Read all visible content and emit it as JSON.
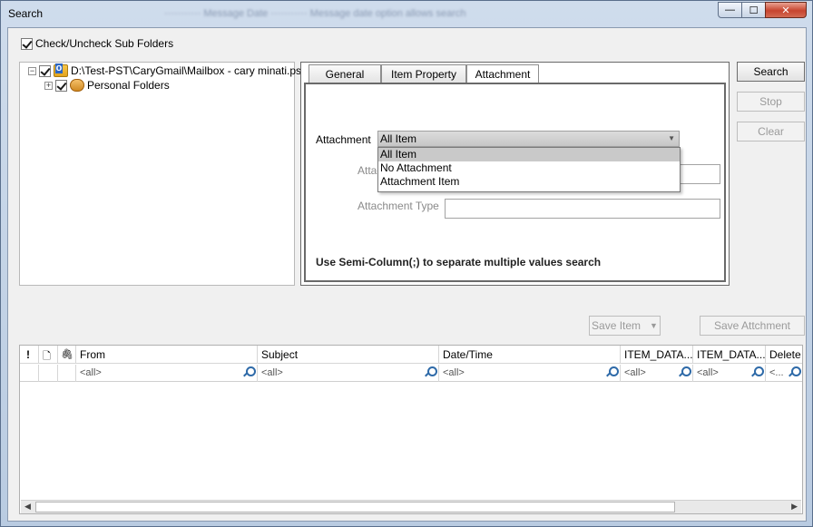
{
  "window": {
    "title": "Search",
    "controls": {
      "minimize": "—",
      "maximize": "☐",
      "close": "✕"
    }
  },
  "options": {
    "sub_folders_label": "Check/Uncheck Sub Folders",
    "sub_folders_checked": true
  },
  "tree": {
    "root": {
      "label": "D:\\Test-PST\\CaryGmail\\Mailbox - cary minati.pst",
      "expander": "−",
      "checked": true
    },
    "child": {
      "label": "Personal Folders",
      "expander": "+",
      "checked": true
    }
  },
  "tabs": {
    "general": "General",
    "item_property": "Item Property",
    "attachment": "Attachment",
    "active": "Attachment"
  },
  "attachment_tab": {
    "attachment_label": "Attachment",
    "selected": "All Item",
    "options": [
      "All Item",
      "No Attachment",
      "Attachment Item"
    ],
    "name_label_partial": "Attac",
    "type_label": "Attachment Type",
    "hint": "Use Semi-Column(;) to separate multiple values search"
  },
  "buttons": {
    "search": "Search",
    "stop": "Stop",
    "clear": "Clear",
    "save_item": "Save Item",
    "save_attachment": "Save Attchment"
  },
  "grid": {
    "icon_columns": [
      "!",
      "🗋",
      "🖇"
    ],
    "columns": [
      "From",
      "Subject",
      "Date/Time",
      "ITEM_DATA...",
      "ITEM_DATA...",
      "Delete"
    ],
    "filter_placeholder": "<all>",
    "filter_placeholder_short": "<..."
  }
}
